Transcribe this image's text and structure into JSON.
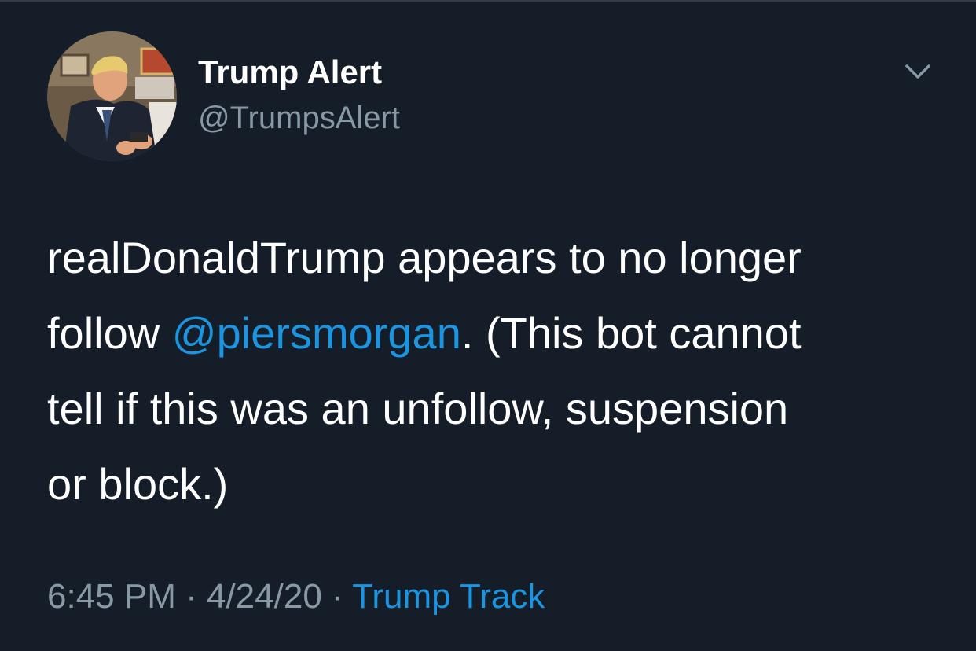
{
  "author": {
    "display_name": "Trump Alert",
    "handle": "@TrumpsAlert",
    "avatar_icon": "profile-photo"
  },
  "menu": {
    "icon": "chevron-down-icon"
  },
  "tweet": {
    "line1": "realDonaldTrump appears to no longer",
    "line2_prefix": "follow ",
    "mention": "@piersmorgan",
    "line2_suffix": ". (This bot cannot",
    "line3": "tell if this was an unfollow, suspension",
    "line4": "or block.)"
  },
  "meta": {
    "time": "6:45 PM",
    "separator1": " · ",
    "date": "4/24/20",
    "separator2": " · ",
    "source": "Trump Track"
  },
  "colors": {
    "background": "#151d28",
    "link": "#1b95e0",
    "secondary_text": "#8899a6"
  }
}
